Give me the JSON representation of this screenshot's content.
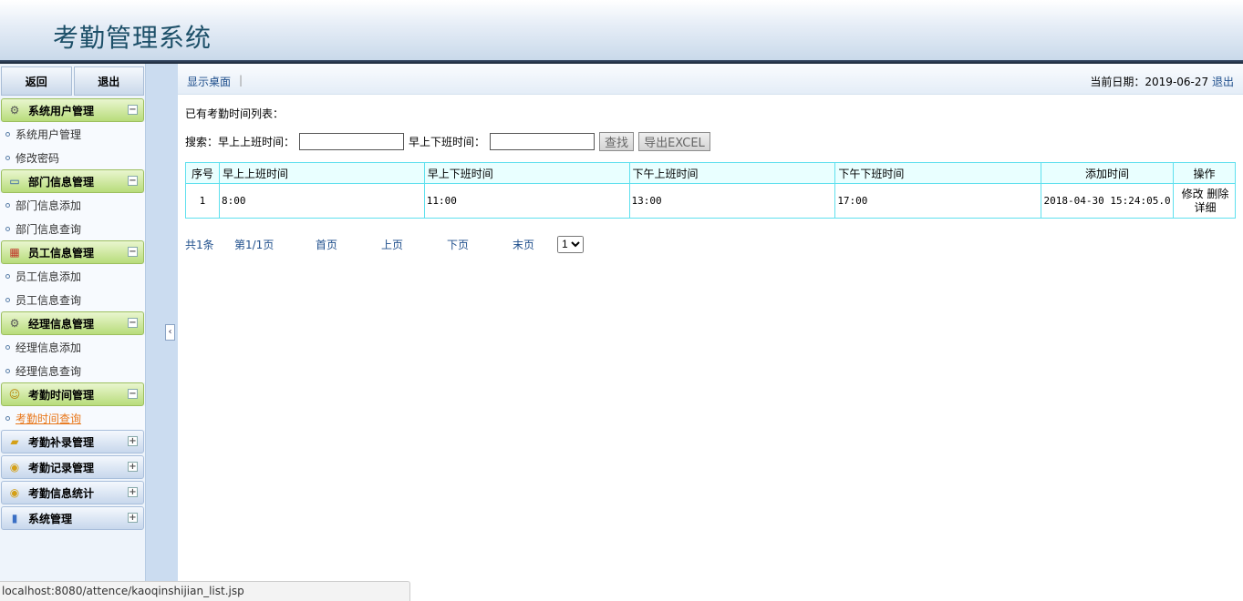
{
  "header": {
    "title": "考勤管理系统"
  },
  "sidebar": {
    "back": "返回",
    "logout": "退出",
    "groups": [
      {
        "title": "系统用户管理",
        "icon": "gear-icon",
        "expanded": true,
        "items": [
          "系统用户管理",
          "修改密码"
        ]
      },
      {
        "title": "部门信息管理",
        "icon": "monitor-icon",
        "expanded": true,
        "items": [
          "部门信息添加",
          "部门信息查询"
        ]
      },
      {
        "title": "员工信息管理",
        "icon": "calendar-icon",
        "expanded": true,
        "items": [
          "员工信息添加",
          "员工信息查询"
        ]
      },
      {
        "title": "经理信息管理",
        "icon": "gear-icon",
        "expanded": true,
        "items": [
          "经理信息添加",
          "经理信息查询"
        ]
      },
      {
        "title": "考勤时间管理",
        "icon": "person-icon",
        "expanded": true,
        "items": [
          "考勤时间查询"
        ]
      },
      {
        "title": "考勤补录管理",
        "icon": "folder-icon",
        "expanded": false,
        "items": []
      },
      {
        "title": "考勤记录管理",
        "icon": "coins-icon",
        "expanded": false,
        "items": []
      },
      {
        "title": "考勤信息统计",
        "icon": "coins-icon",
        "expanded": false,
        "items": []
      },
      {
        "title": "系统管理",
        "icon": "bar-chart-icon",
        "expanded": false,
        "items": []
      }
    ],
    "toggle_minus": "−",
    "toggle_plus": "+"
  },
  "splitter": {
    "arrow": "‹"
  },
  "topbar": {
    "desktop_link": "显示桌面",
    "separator": "|",
    "date_label": "当前日期：2019-06-27",
    "logout": "退出"
  },
  "main": {
    "list_title": "已有考勤时间列表：",
    "search": {
      "label": "搜索：",
      "field1_label": "早上上班时间：",
      "field1_value": "",
      "field2_label": "早上下班时间：",
      "field2_value": "",
      "find_button": "查找",
      "export_button": "导出EXCEL"
    },
    "table": {
      "headers": [
        "序号",
        "早上上班时间",
        "早上下班时间",
        "下午上班时间",
        "下午下班时间",
        "添加时间",
        "操作"
      ],
      "rows": [
        {
          "no": "1",
          "am_in": "8:00",
          "am_out": "11:00",
          "pm_in": "13:00",
          "pm_out": "17:00",
          "added": "2018-04-30 15:24:05.0",
          "edit": "修改",
          "delete": "删除",
          "detail": "详细"
        }
      ]
    },
    "pager": {
      "total": "共1条",
      "page": "第1/1页",
      "first": "首页",
      "prev": "上页",
      "next": "下页",
      "last": "末页",
      "select_value": "1"
    }
  },
  "statusbar": {
    "url": "localhost:8080/attence/kaoqinshijian_list.jsp"
  }
}
